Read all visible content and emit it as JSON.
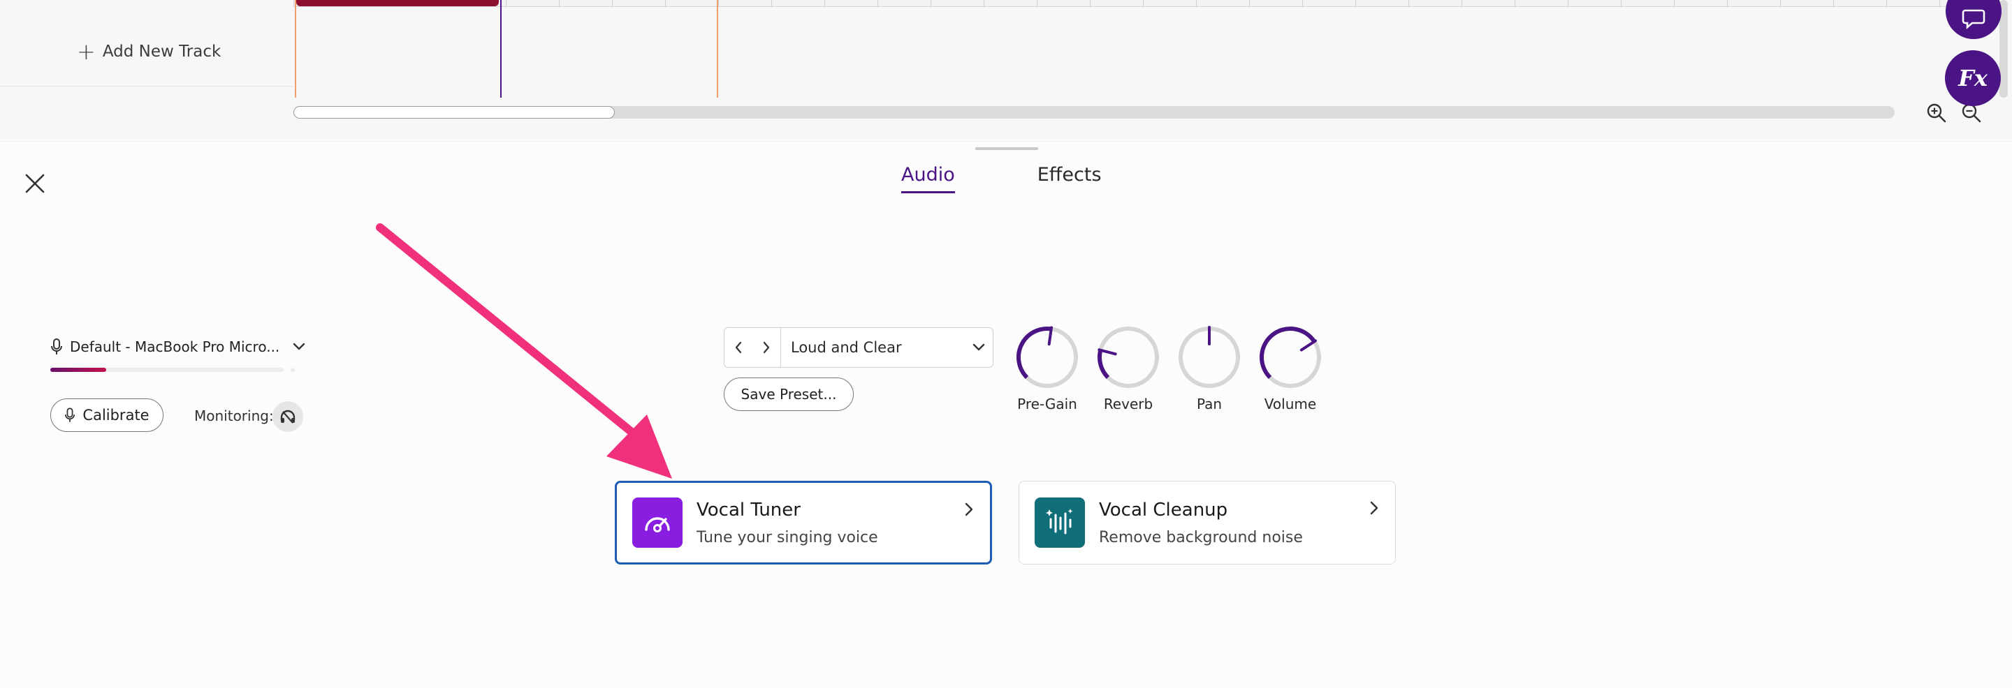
{
  "timeline": {
    "add_track_label": "Add New Track",
    "clip_color": "#8e1030",
    "playhead_color": "#4a1484",
    "loop_marker_color": "#f0a070"
  },
  "floating": {
    "fx_label": "Fx",
    "chat_icon": "chat-bubble-icon"
  },
  "panel": {
    "tabs": [
      {
        "label": "Audio",
        "active": true
      },
      {
        "label": "Effects",
        "active": false
      }
    ],
    "input": {
      "device_label": "Default - MacBook Pro Micro...",
      "level_fraction": 0.24,
      "calibrate_label": "Calibrate",
      "monitoring_label": "Monitoring:"
    },
    "preset": {
      "name": "Loud and Clear",
      "save_label": "Save Preset..."
    },
    "knobs": [
      {
        "label": "Pre-Gain",
        "value": 0.53
      },
      {
        "label": "Reverb",
        "value": 0.22
      },
      {
        "label": "Pan",
        "value": 0.5
      },
      {
        "label": "Volume",
        "value": 0.71
      }
    ],
    "cards": [
      {
        "title": "Vocal Tuner",
        "subtitle": "Tune your singing voice",
        "icon": "gauge-icon",
        "icon_color": "#8a1ee0",
        "selected": true
      },
      {
        "title": "Vocal Cleanup",
        "subtitle": "Remove background noise",
        "icon": "waveform-sparkle-icon",
        "icon_color": "#0f6e78",
        "selected": false
      }
    ]
  },
  "colors": {
    "accent": "#4a1484",
    "selection": "#1e5bb5",
    "annotation_arrow": "#f0307a"
  }
}
